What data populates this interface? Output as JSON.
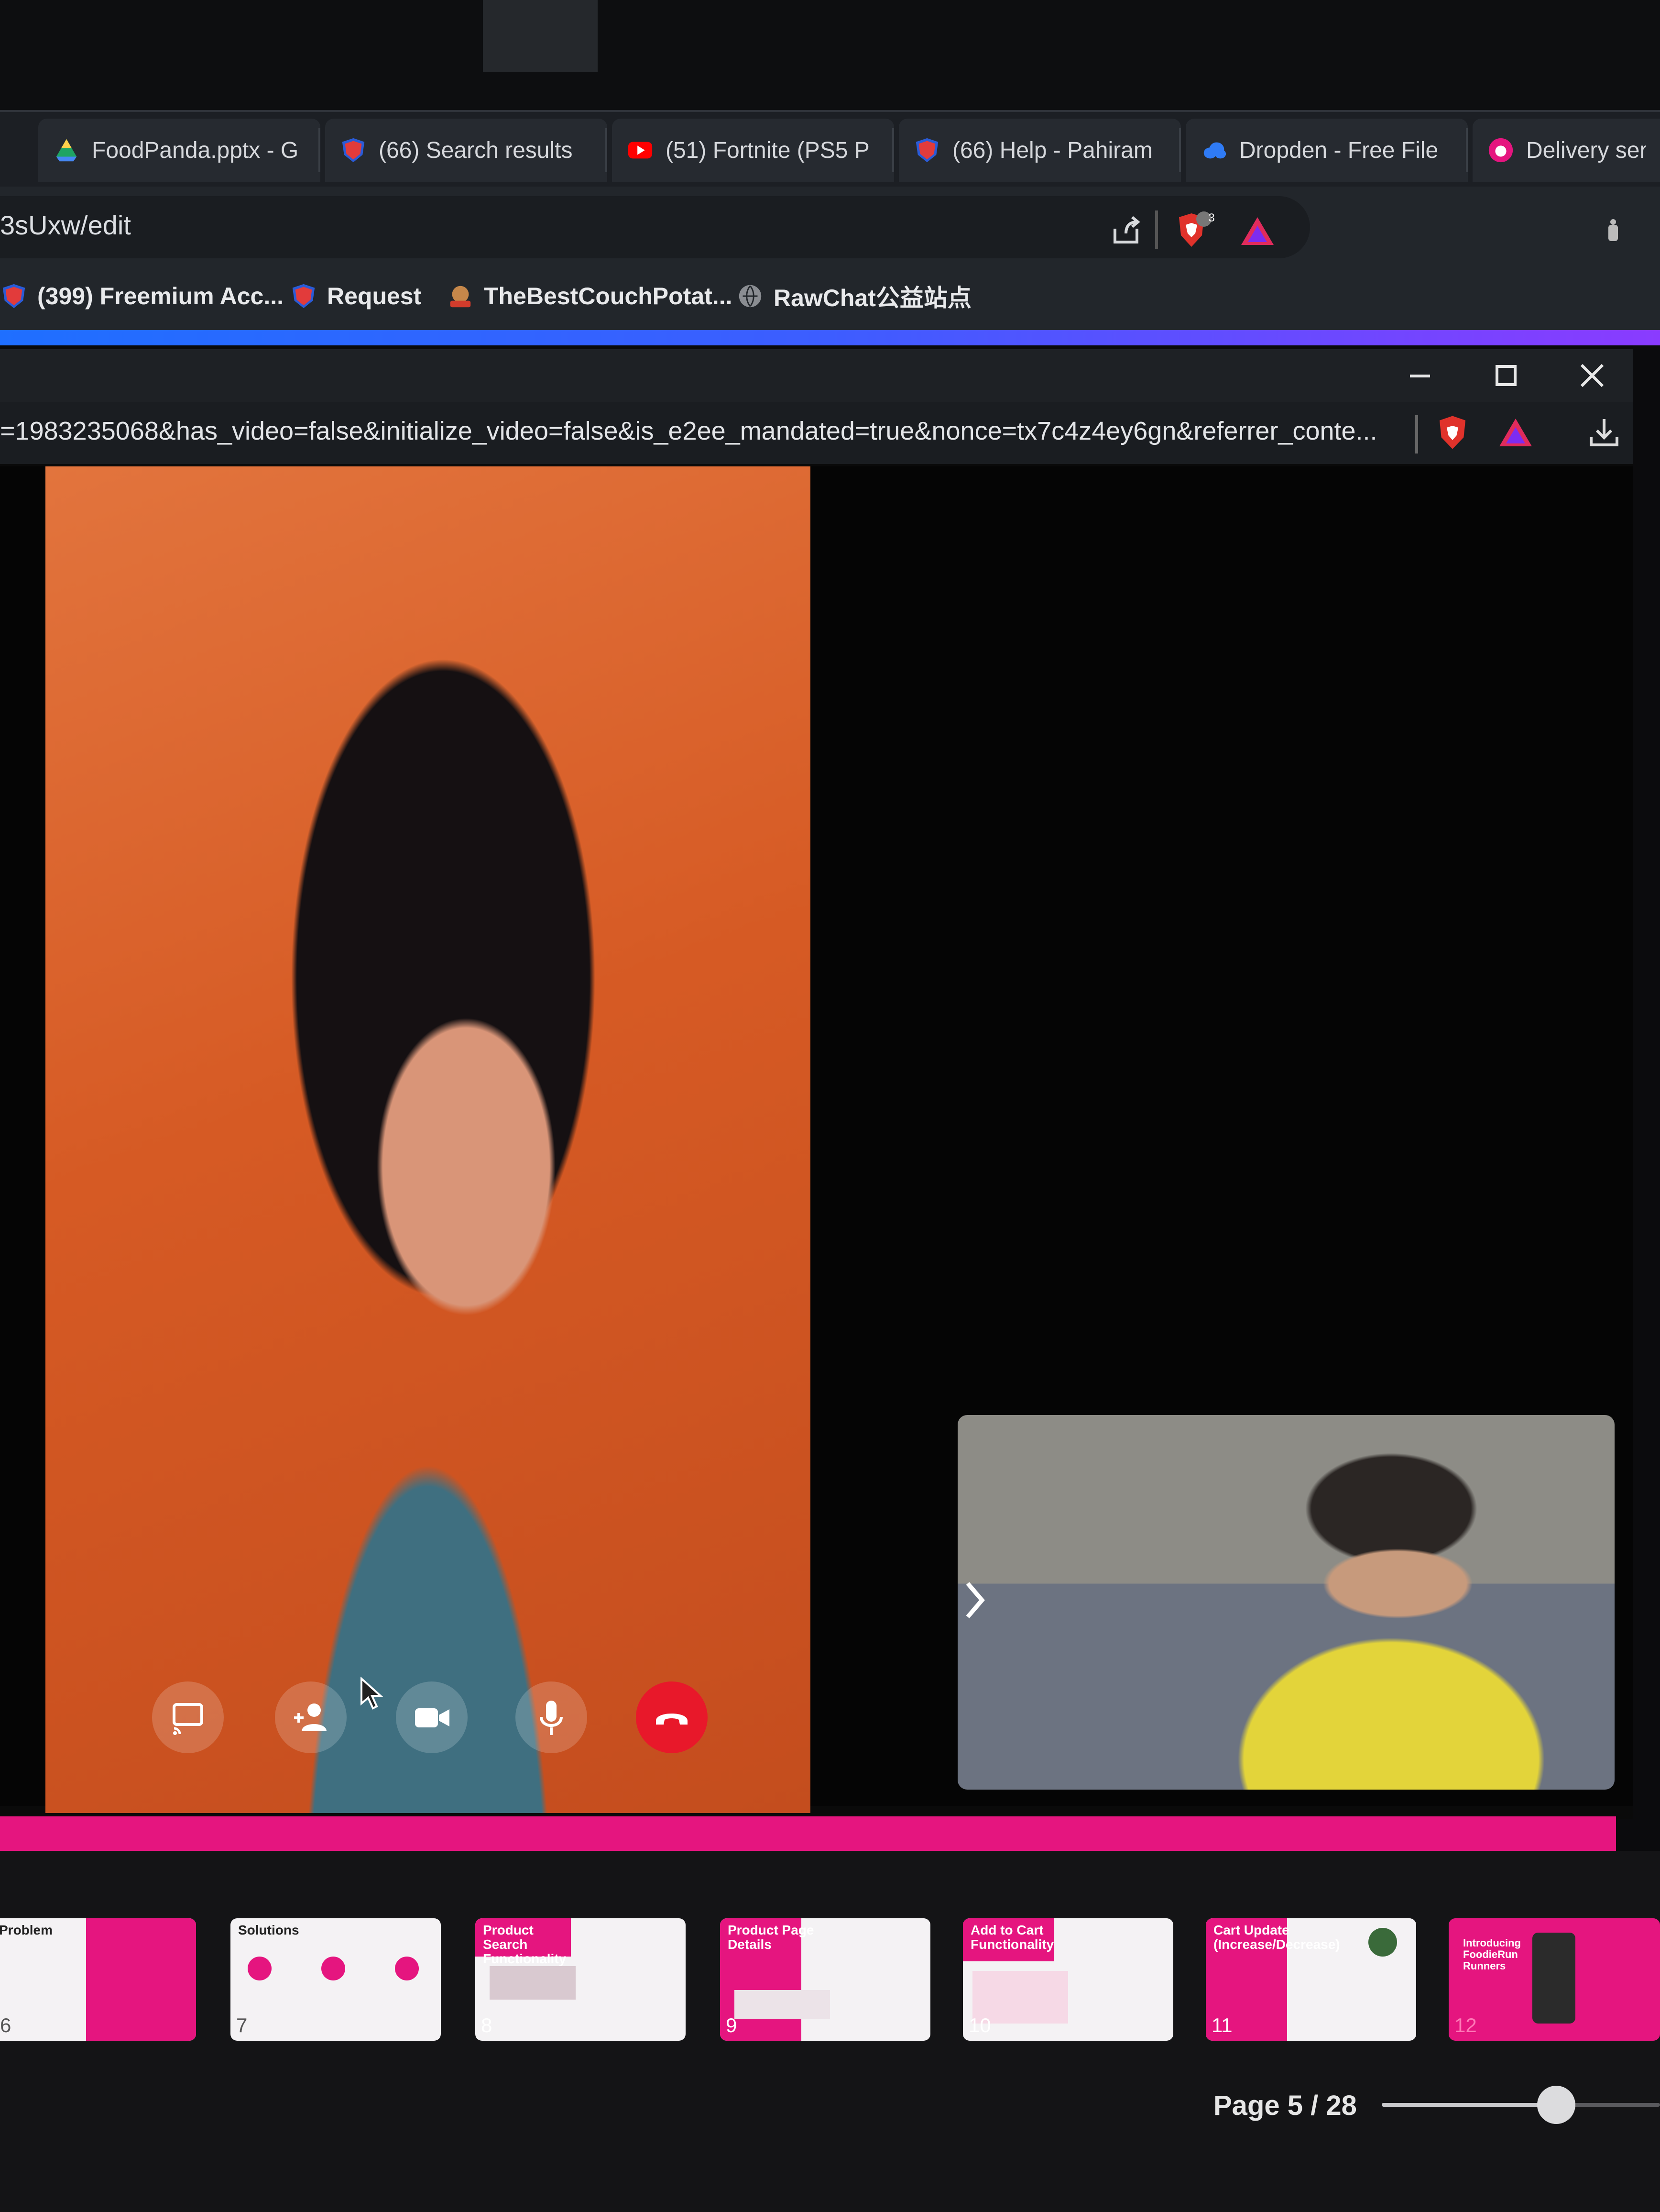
{
  "tabs": [
    {
      "label": "FoodPanda.pptx - G",
      "icon": "google-drive-icon"
    },
    {
      "label": "(66) Search results",
      "icon": "shield-logo-icon"
    },
    {
      "label": "(51) Fortnite (PS5 P",
      "icon": "youtube-icon"
    },
    {
      "label": "(66) Help - Pahiram",
      "icon": "shield-logo-icon"
    },
    {
      "label": "Dropden - Free File",
      "icon": "cloud-icon"
    },
    {
      "label": "Delivery serv",
      "icon": "foodpanda-icon"
    }
  ],
  "address_bar": {
    "url": "3sUxw/edit",
    "brave_shields_count": "3"
  },
  "bookmarks": [
    {
      "label": "(399) Freemium Acc...",
      "icon": "shield-logo-icon"
    },
    {
      "label": "Request",
      "icon": "shield-logo-icon"
    },
    {
      "label": "TheBestCouchPotat...",
      "icon": "couch-potato-icon"
    },
    {
      "label": "RawChat公益站点",
      "icon": "globe-icon"
    }
  ],
  "call_window": {
    "url": "=1983235068&has_video=false&initialize_video=false&is_e2ee_mandated=true&nonce=tx7c4z4ey6gn&referrer_conte...",
    "controls": [
      "screen-share",
      "add-person",
      "video-camera",
      "microphone",
      "end-call"
    ]
  },
  "slides": [
    {
      "number": "6",
      "title": "Problem"
    },
    {
      "number": "7",
      "title": "Solutions"
    },
    {
      "number": "8",
      "title": "Product Search Functionality"
    },
    {
      "number": "9",
      "title": "Product Page Details"
    },
    {
      "number": "10",
      "title": "Add to Cart Functionality"
    },
    {
      "number": "11",
      "title": "Cart Update (Increase/Decrease)"
    },
    {
      "number": "12",
      "title": "Introducing FoodieRun Runners"
    }
  ],
  "pager": {
    "label": "Page 5 / 28",
    "zoom_fraction": 0.6
  },
  "colors": {
    "accent_pink": "#e5157f",
    "end_call_red": "#e8182a",
    "browser_gradient_start": "#1f6fff",
    "browser_gradient_end": "#8a3bff"
  }
}
